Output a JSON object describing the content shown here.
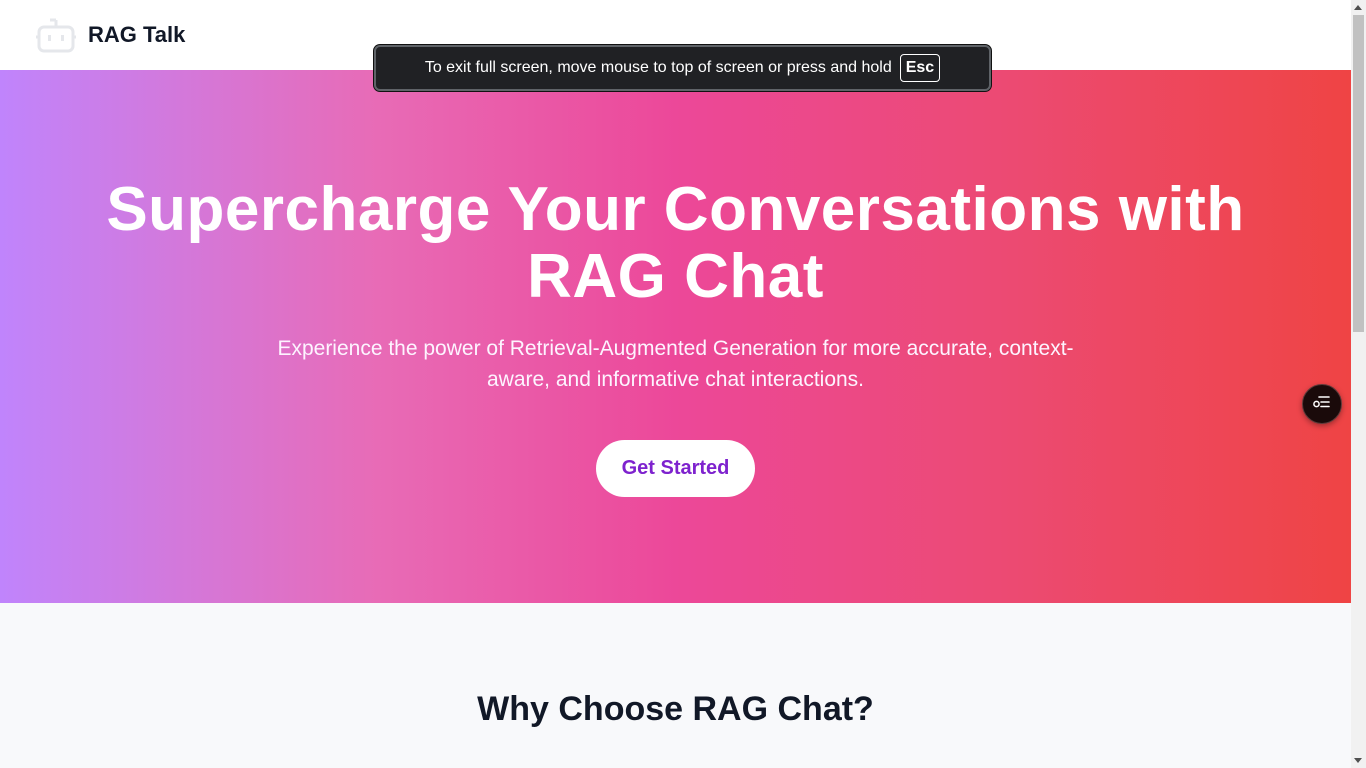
{
  "header": {
    "brand": "RAG Talk",
    "logo_icon": "robot-icon"
  },
  "hero": {
    "title": "Supercharge Your Conversations with RAG Chat",
    "subtitle": "Experience the power of Retrieval-Augmented Generation for more accurate, context-aware, and informative chat interactions.",
    "cta_label": "Get Started",
    "gradient_start": "#c084fc",
    "gradient_mid": "#ec4899",
    "gradient_end": "#ef4444",
    "cta_text_color": "#7e22ce"
  },
  "features": {
    "title": "Why Choose RAG Chat?"
  },
  "fullscreen_toast": {
    "message": "To exit full screen, move mouse to top of screen or press and hold",
    "key": "Esc"
  },
  "chat_widget": {
    "icon": "chat-list-icon"
  }
}
